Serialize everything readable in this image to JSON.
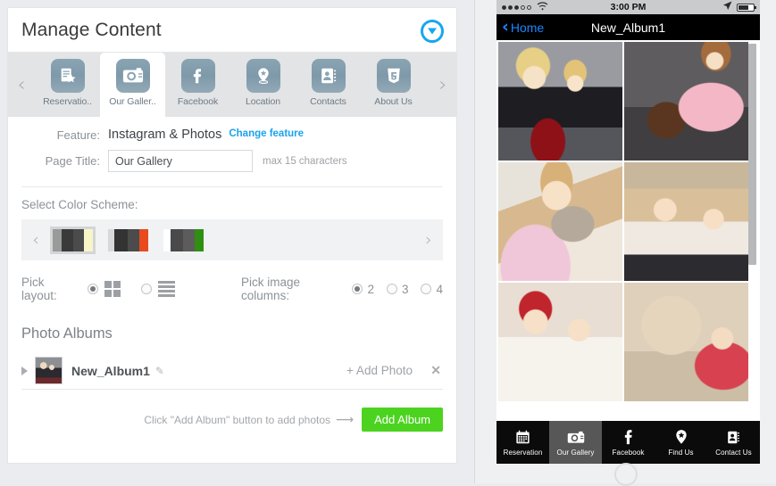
{
  "editor": {
    "header": {
      "title": "Manage Content",
      "collapse_icon": "chevron-down-circle-icon"
    },
    "tabs": {
      "prev_arrow": "‹",
      "next_arrow": "›",
      "items": [
        {
          "label": "Reservatio..",
          "icon": "reservation-icon",
          "active": false
        },
        {
          "label": "Our Galler..",
          "icon": "camera-icon",
          "active": true
        },
        {
          "label": "Facebook",
          "icon": "facebook-icon",
          "active": false
        },
        {
          "label": "Location",
          "icon": "map-pin-icon",
          "active": false
        },
        {
          "label": "Contacts",
          "icon": "contacts-book-icon",
          "active": false
        },
        {
          "label": "About Us",
          "icon": "html5-shield-icon",
          "active": false
        }
      ]
    },
    "feature": {
      "label": "Feature:",
      "value": "Instagram & Photos",
      "change_link": "Change feature"
    },
    "page_title": {
      "label": "Page Title:",
      "value": "Our Gallery",
      "placeholder": "Our Gallery",
      "hint": "max 15 characters"
    },
    "color_scheme": {
      "label": "Select Color Scheme:",
      "prev_arrow": "‹",
      "next_arrow": "›",
      "selected_index": 0,
      "swatches": [
        {
          "name": "cream",
          "colors": [
            "#9a9a9a",
            "#3a3a3a",
            "#4b4b4b",
            "#f8f6c8"
          ]
        },
        {
          "name": "orange",
          "colors": [
            "#d8d8d8",
            "#333333",
            "#4b4b4b",
            "#e8491f"
          ]
        },
        {
          "name": "green",
          "colors": [
            "#ffffff",
            "#4a4a4a",
            "#5c5c5c",
            "#2f8f13"
          ]
        }
      ]
    },
    "layout": {
      "label": "Pick layout:",
      "options": [
        {
          "name": "grid",
          "selected": true
        },
        {
          "name": "list",
          "selected": false
        }
      ]
    },
    "columns": {
      "label": "Pick image columns:",
      "options": [
        {
          "label": "2",
          "selected": true
        },
        {
          "label": "3",
          "selected": false
        },
        {
          "label": "4",
          "selected": false
        }
      ]
    },
    "albums": {
      "title": "Photo Albums",
      "rows": [
        {
          "name": "New_Album1",
          "edit_icon": "pencil-icon",
          "add_photo_label": "+ Add Photo",
          "delete_icon": "close-icon"
        }
      ],
      "hint": "Click \"Add Album\" button to add photos",
      "hint_arrow": "⟶",
      "add_button_label": "Add Album",
      "add_button_color": "#4cd320"
    }
  },
  "preview": {
    "status_bar": {
      "signal": [
        true,
        true,
        true,
        false,
        false
      ],
      "wifi_icon": "wifi-icon",
      "time": "3:00 PM",
      "location_icon": "location-arrow-icon",
      "battery_icon": "battery-icon"
    },
    "nav_bar": {
      "back_icon": "chevron-left-icon",
      "back_label": "Home",
      "title": "New_Album1",
      "back_color": "#1a86ff"
    },
    "photos": [
      {
        "alt": "two-girls-with-red-flowers",
        "style": "ph-1"
      },
      {
        "alt": "girl-in-pink-tutu-with-chair",
        "style": "ph-2"
      },
      {
        "alt": "toddler-hugging-teddy-bear",
        "style": "ph-3"
      },
      {
        "alt": "kids-holding-gold-picture-frames",
        "style": "ph-4"
      },
      {
        "alt": "babies-in-santa-hat-with-lights",
        "style": "ph-5"
      },
      {
        "alt": "baby-lying-with-husky-dog",
        "style": "ph-6"
      }
    ],
    "tab_bar": [
      {
        "label": "Reservation",
        "icon": "calendar-icon",
        "active": false
      },
      {
        "label": "Our Gallery",
        "icon": "camera-icon",
        "active": true
      },
      {
        "label": "Facebook",
        "icon": "facebook-icon",
        "active": false
      },
      {
        "label": "Find Us",
        "icon": "map-pin-icon",
        "active": false
      },
      {
        "label": "Contact Us",
        "icon": "contacts-book-icon",
        "active": false
      }
    ]
  }
}
